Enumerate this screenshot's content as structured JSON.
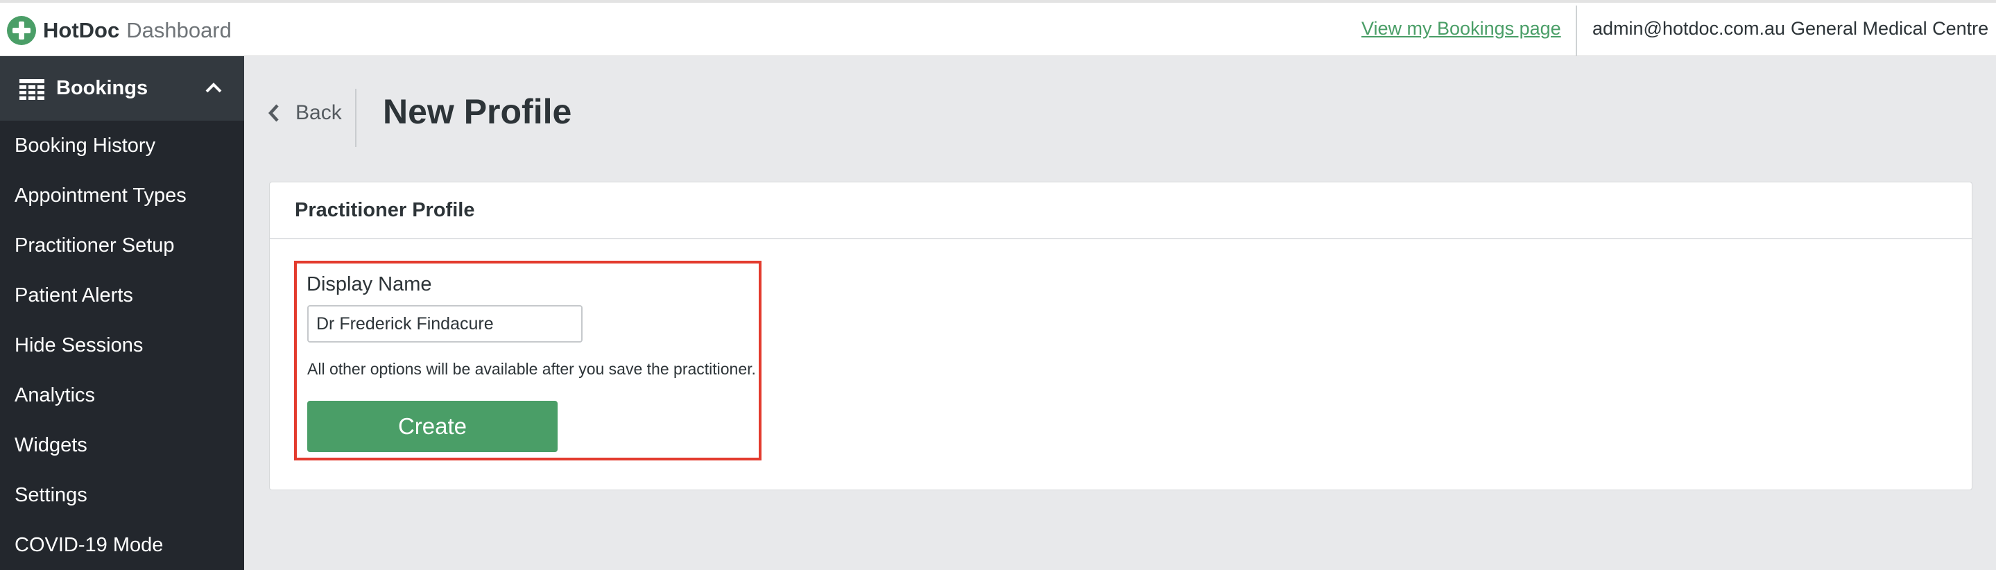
{
  "header": {
    "brand": "HotDoc",
    "product": "Dashboard",
    "bookings_link": "View my Bookings page",
    "user_email": "admin@hotdoc.com.au",
    "clinic_name": "General Medical Centre"
  },
  "sidebar": {
    "section_label": "Bookings",
    "items": [
      {
        "label": "Booking History"
      },
      {
        "label": "Appointment Types"
      },
      {
        "label": "Practitioner Setup"
      },
      {
        "label": "Patient Alerts"
      },
      {
        "label": "Hide Sessions"
      },
      {
        "label": "Analytics"
      },
      {
        "label": "Widgets"
      },
      {
        "label": "Settings"
      },
      {
        "label": "COVID-19 Mode"
      }
    ]
  },
  "main": {
    "back_label": "Back",
    "page_title": "New Profile",
    "card_title": "Practitioner Profile",
    "field_label": "Display Name",
    "display_name_value": "Dr Frederick Findacure",
    "help_text": "All other options will be available after you save the practitioner.",
    "create_label": "Create"
  },
  "colors": {
    "brand_green": "#4a9e67",
    "sidebar_bg": "#23272d",
    "highlight_red": "#e33b2e"
  }
}
